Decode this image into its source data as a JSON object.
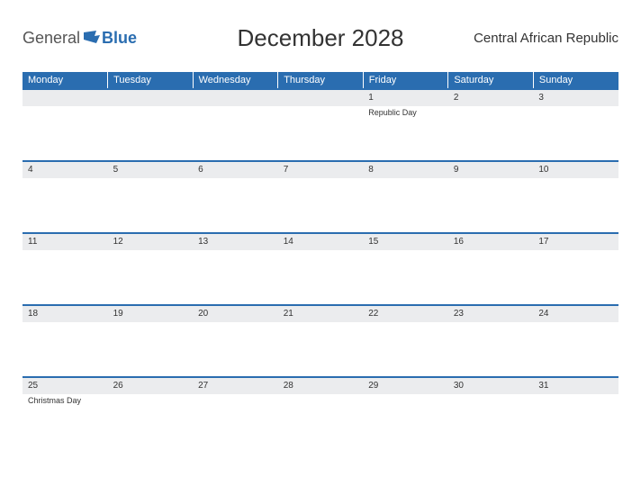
{
  "logo": {
    "general": "General",
    "blue": "Blue"
  },
  "title": "December 2028",
  "region": "Central African Republic",
  "days": [
    "Monday",
    "Tuesday",
    "Wednesday",
    "Thursday",
    "Friday",
    "Saturday",
    "Sunday"
  ],
  "weeks": [
    [
      {
        "date": "",
        "event": ""
      },
      {
        "date": "",
        "event": ""
      },
      {
        "date": "",
        "event": ""
      },
      {
        "date": "",
        "event": ""
      },
      {
        "date": "1",
        "event": "Republic Day"
      },
      {
        "date": "2",
        "event": ""
      },
      {
        "date": "3",
        "event": ""
      }
    ],
    [
      {
        "date": "4",
        "event": ""
      },
      {
        "date": "5",
        "event": ""
      },
      {
        "date": "6",
        "event": ""
      },
      {
        "date": "7",
        "event": ""
      },
      {
        "date": "8",
        "event": ""
      },
      {
        "date": "9",
        "event": ""
      },
      {
        "date": "10",
        "event": ""
      }
    ],
    [
      {
        "date": "11",
        "event": ""
      },
      {
        "date": "12",
        "event": ""
      },
      {
        "date": "13",
        "event": ""
      },
      {
        "date": "14",
        "event": ""
      },
      {
        "date": "15",
        "event": ""
      },
      {
        "date": "16",
        "event": ""
      },
      {
        "date": "17",
        "event": ""
      }
    ],
    [
      {
        "date": "18",
        "event": ""
      },
      {
        "date": "19",
        "event": ""
      },
      {
        "date": "20",
        "event": ""
      },
      {
        "date": "21",
        "event": ""
      },
      {
        "date": "22",
        "event": ""
      },
      {
        "date": "23",
        "event": ""
      },
      {
        "date": "24",
        "event": ""
      }
    ],
    [
      {
        "date": "25",
        "event": "Christmas Day"
      },
      {
        "date": "26",
        "event": ""
      },
      {
        "date": "27",
        "event": ""
      },
      {
        "date": "28",
        "event": ""
      },
      {
        "date": "29",
        "event": ""
      },
      {
        "date": "30",
        "event": ""
      },
      {
        "date": "31",
        "event": ""
      }
    ]
  ]
}
